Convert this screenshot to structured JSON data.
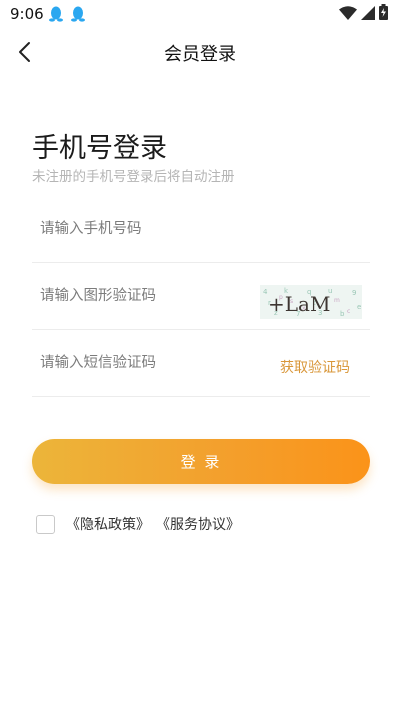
{
  "status_bar": {
    "time": "9:06",
    "left_icons": [
      "qq-penguin-icon",
      "qq-penguin-icon"
    ],
    "right_icons": [
      "wifi-icon",
      "cellular-signal-icon",
      "battery-charging-icon"
    ]
  },
  "nav": {
    "back_icon": "chevron-left-icon",
    "title": "会员登录"
  },
  "login": {
    "title": "手机号登录",
    "subtitle": "未注册的手机号登录后将自动注册"
  },
  "form": {
    "phone": {
      "placeholder": "请输入手机号码",
      "value": ""
    },
    "captcha": {
      "placeholder": "请输入图形验证码",
      "value": "",
      "image_text": "+LaM"
    },
    "sms": {
      "placeholder": "请输入短信验证码",
      "value": "",
      "button_label": "获取验证码"
    }
  },
  "login_button": {
    "label": "登 录"
  },
  "agreement": {
    "checked": false,
    "links": [
      "《隐私政策》",
      "《服务协议》"
    ]
  },
  "colors": {
    "accent_start": "#ecb53a",
    "accent_end": "#fb9319",
    "sms_link": "#d9973a",
    "subtitle": "#b5b5b5"
  }
}
